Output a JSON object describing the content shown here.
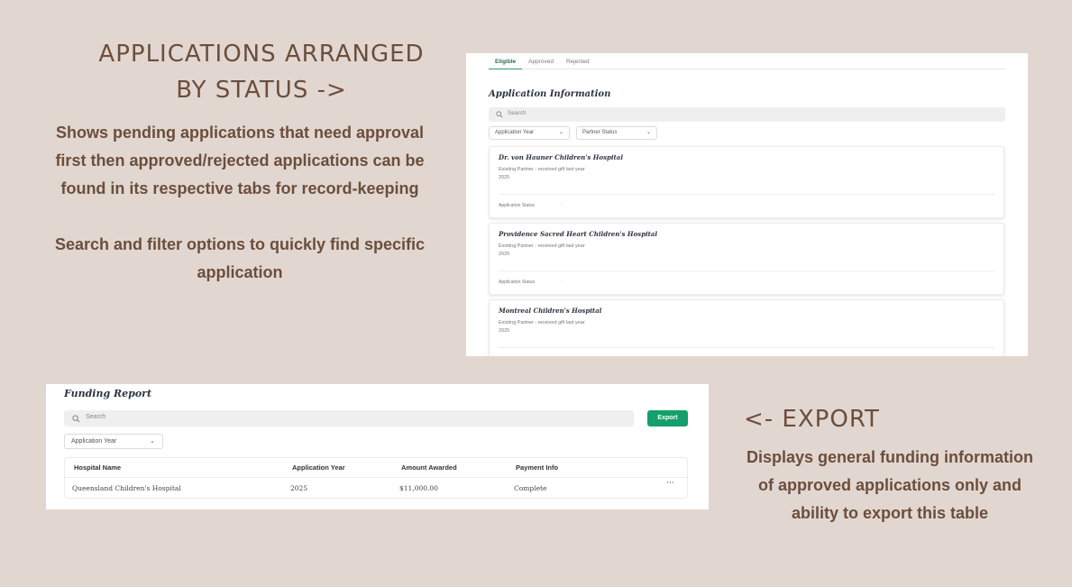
{
  "annotations": {
    "status_title_line1": "APPLICATIONS ARRANGED",
    "status_title_line2": "BY STATUS ->",
    "status_desc_line1": "Shows pending applications that need approval",
    "status_desc_line2": "first then approved/rejected applications can be",
    "status_desc_line3": "found in its respective tabs for record-keeping",
    "search_desc_line1": "Search and filter options to quickly find specific",
    "search_desc_line2": "application",
    "export_title": "<-  EXPORT",
    "export_desc_line1": "Displays general funding information",
    "export_desc_line2": "of approved applications only and",
    "export_desc_line3": "ability to export this table"
  },
  "applications": {
    "tabs": [
      "Eligible",
      "Approved",
      "Rejected"
    ],
    "title": "Application Information",
    "search_placeholder": "Search",
    "filters": [
      "Application Year",
      "Partner Status"
    ],
    "cards": [
      {
        "name": "Dr. von Hauner Children's Hospital",
        "partner": "Existing Partner - received gift last year",
        "year": "2025",
        "status_label": "Application Status"
      },
      {
        "name": "Providence Sacred Heart Children's Hospital",
        "partner": "Existing Partner - received gift last year",
        "year": "2025",
        "status_label": "Application Status"
      },
      {
        "name": "Montreal Children's Hospital",
        "partner": "Existing Partner - received gift last year",
        "year": "2025",
        "status_label": ""
      }
    ]
  },
  "funding": {
    "title": "Funding Report",
    "search_placeholder": "Search",
    "export_label": "Export",
    "filter": "Application Year",
    "columns": [
      "Hospital Name",
      "Application Year",
      "Amount Awarded",
      "Payment Info"
    ],
    "rows": [
      {
        "hospital": "Queensland Children's Hospital",
        "year": "2025",
        "amount": "$11,000.00",
        "payment": "Complete"
      }
    ]
  },
  "colors": {
    "background": "#e2d7d0",
    "annotation_text": "#6b4e3d",
    "accent_green": "#15a06b"
  }
}
